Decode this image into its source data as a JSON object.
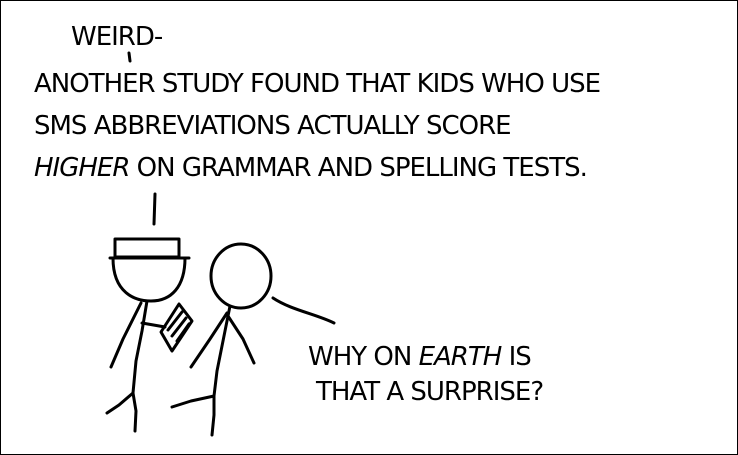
{
  "comic": {
    "speaker1": {
      "interjection": "Weird-",
      "line1": "Another study found that kids who use",
      "line2": "SMS abbreviations actually score",
      "line3_em": "higher",
      "line3_rest": " on grammar and spelling tests."
    },
    "speaker2": {
      "line1_pre": "Why on ",
      "line1_em": "earth",
      "line1_post": " is",
      "line2": "that a surprise?"
    }
  },
  "colors": {
    "ink": "#000000",
    "background": "#ffffff"
  }
}
